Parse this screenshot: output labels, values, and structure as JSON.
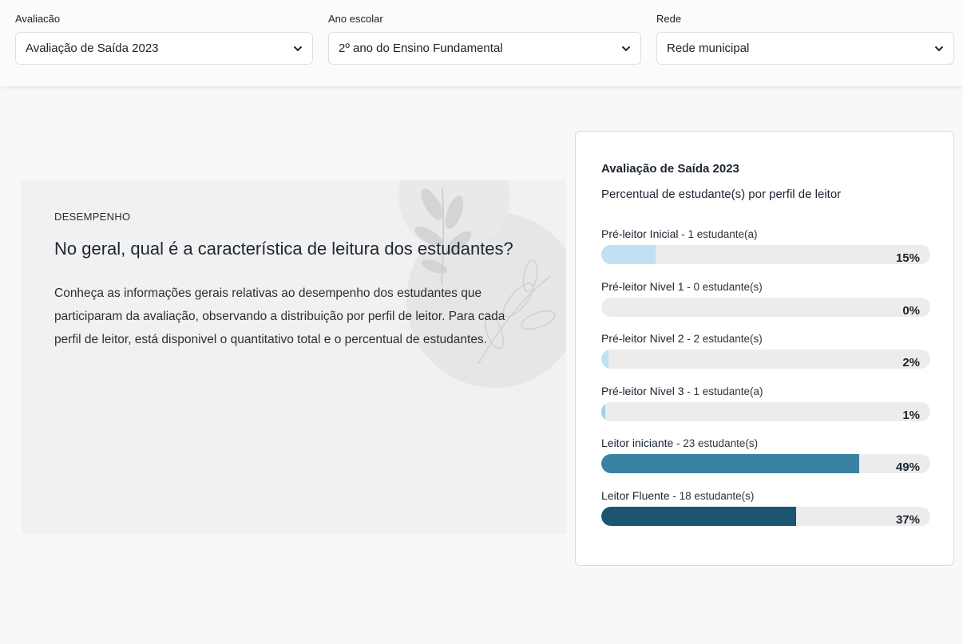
{
  "filters": [
    {
      "label": "Avaliacão",
      "value": "Avaliação de Saída 2023"
    },
    {
      "label": "Ano escolar",
      "value": "2º ano do Ensino Fundamental"
    },
    {
      "label": "Rede",
      "value": "Rede municipal"
    }
  ],
  "hero": {
    "eyebrow": "DESEMPENHO",
    "headline": "No geral, qual é a característica de leitura dos estudantes?",
    "description": "Conheça as informações gerais relativas ao desempenho dos estudantes que participaram da avaliação, observando a distribuição por perfil de leitor. Para cada perfil de leitor, está disponivel o quantitativo total e o percentual de estudantes."
  },
  "card": {
    "title": "Avaliação de Saída 2023",
    "subtitle": "Percentual de estudante(s) por perfil de leitor",
    "rows": [
      {
        "name": "Pré-leitor Inicial",
        "count": " - 1 estudante(a)",
        "percent": 15,
        "percent_label": "15%",
        "color": "#bfe1f3"
      },
      {
        "name": "Pré-leitor Nivel 1",
        "count": " - 0 estudante(s)",
        "percent": 0,
        "percent_label": "0%",
        "color": "#bfe1f3"
      },
      {
        "name": "Pré-leitor Nivel 2",
        "count": " - 2 estudante(s)",
        "percent": 2,
        "percent_label": "2%",
        "color": "#bfe1f3"
      },
      {
        "name": "Pré-leitor Nivel 3",
        "count": " - 1 estudante(a)",
        "percent": 1,
        "percent_label": "1%",
        "color": "#9fd0ec"
      },
      {
        "name": "Leitor iniciante",
        "count": " - 23 estudante(s)",
        "percent": 49,
        "percent_label": "49%",
        "color": "#3a82a5"
      },
      {
        "name": "Leitor Fluente",
        "count": " - 18 estudante(s)",
        "percent": 37,
        "percent_label": "37%",
        "color": "#1b5572"
      }
    ]
  },
  "icons": {
    "dropdown": "chevron-down-icon"
  },
  "colors": {
    "page_bg": "#f8f8f8",
    "hero_bg": "#f1f1f1",
    "track": "#ececec"
  }
}
